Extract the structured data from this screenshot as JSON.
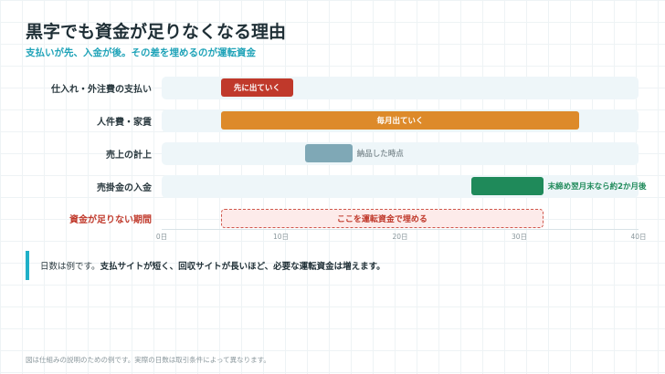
{
  "title": "黒字でも資金が足りなくなる理由",
  "subtitle": "支払いが先、入金が後。その差を埋めるのが運転資金",
  "chart_data": {
    "type": "gantt",
    "xlim": [
      0,
      40
    ],
    "ticks": [
      "0日",
      "10日",
      "20日",
      "30日",
      "40日"
    ],
    "tick_values": [
      0,
      10,
      20,
      30,
      40
    ],
    "rows": [
      {
        "label": "仕入れ・外注費の支払い",
        "start": 5,
        "end": 11,
        "bar_text": "先に出ていく",
        "side_text": "",
        "color": "#c0392b",
        "side_color": ""
      },
      {
        "label": "人件費・家賃",
        "start": 5,
        "end": 35,
        "bar_text": "毎月出ていく",
        "side_text": "",
        "color": "#dd8a2a",
        "side_color": ""
      },
      {
        "label": "売上の計上",
        "start": 12,
        "end": 16,
        "bar_text": "",
        "side_text": "納品した時点",
        "color": "#7fa8b6",
        "side_color": "#8a979c"
      },
      {
        "label": "売掛金の入金",
        "start": 26,
        "end": 32,
        "bar_text": "",
        "side_text": "末締め翌月末なら約2か月後",
        "color": "#1f8a5a",
        "side_color": "#1f8a5a"
      }
    ],
    "gap": {
      "label": "資金が足りない期間",
      "start": 5,
      "end": 32,
      "text": "ここを運転資金で埋める"
    }
  },
  "note": {
    "prefix": "日数は例です。",
    "emphasis": "支払サイトが短く、回収サイトが長いほど、必要な運転資金は増えます。"
  },
  "footer": "図は仕組みの説明のための例です。実際の日数は取引条件によって異なります。"
}
